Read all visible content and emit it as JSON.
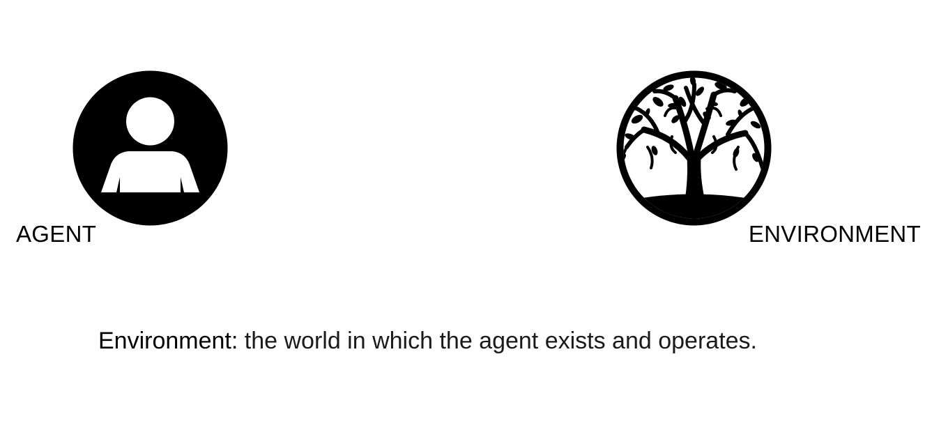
{
  "diagram": {
    "nodes": [
      {
        "id": "agent",
        "label": "AGENT",
        "icon": "person-icon"
      },
      {
        "id": "environment",
        "label": "ENVIRONMENT",
        "icon": "tree-icon"
      }
    ]
  },
  "definition": {
    "term": "Environment",
    "separator": ":",
    "text": " the world in which the agent exists and operates."
  },
  "colors": {
    "icon_fill": "#000000",
    "background": "#ffffff",
    "text": "#000000"
  }
}
